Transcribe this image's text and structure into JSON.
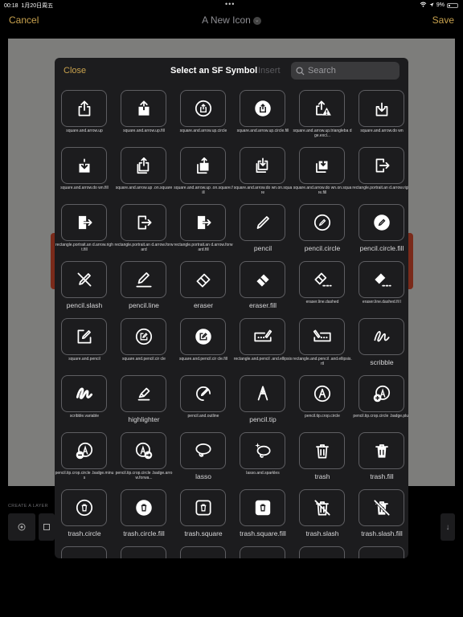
{
  "status": {
    "time": "00:18",
    "date": "1月20日周五",
    "battery": "9%"
  },
  "nav": {
    "cancel": "Cancel",
    "title": "A New Icon",
    "save": "Save"
  },
  "layer": {
    "label": "CREATE A LAYER"
  },
  "modal": {
    "close": "Close",
    "title": "Select an SF Symbol",
    "insert": "Insert",
    "search_placeholder": "Search"
  },
  "symbols": [
    {
      "name": "square.and.arrow.up",
      "size": "small",
      "icon": "share"
    },
    {
      "name": "square.and.arrow.up.fill",
      "size": "small",
      "icon": "share-fill"
    },
    {
      "name": "square.and.arrow.up.circle",
      "size": "small",
      "icon": "share-circle"
    },
    {
      "name": "square.and.arrow.up.circle.fill",
      "size": "small",
      "icon": "share-circle-fill"
    },
    {
      "name": "square.and.arrow.up.triangleba dge.excl...",
      "size": "small",
      "icon": "share-warning"
    },
    {
      "name": "square.and.arrow.do wn",
      "size": "small",
      "icon": "download"
    },
    {
      "name": "square.and.arrow.do wn.fill",
      "size": "small",
      "icon": "download-fill"
    },
    {
      "name": "square.and.arrow.up .on.square",
      "size": "small",
      "icon": "share-on-square"
    },
    {
      "name": "square.and.arrow.up .on.square.fill",
      "size": "small",
      "icon": "share-on-square-fill"
    },
    {
      "name": "square.and.arrow.do wn.on.square",
      "size": "small",
      "icon": "download-on-square"
    },
    {
      "name": "square.and.arrow.do wn.on.square.fill",
      "size": "small",
      "icon": "download-on-square-fill"
    },
    {
      "name": "rectangle.portrait.an d.arrow.right",
      "size": "small",
      "icon": "portrait-arrow"
    },
    {
      "name": "rectangle.portrait.an d.arrow.right.fill",
      "size": "small",
      "icon": "portrait-arrow-fill"
    },
    {
      "name": "rectangle.portrait.an d.arrow.forward",
      "size": "small",
      "icon": "portrait-arrow"
    },
    {
      "name": "rectangle.portrait.an d.arrow.forward.fill",
      "size": "small",
      "icon": "portrait-arrow-fill"
    },
    {
      "name": "pencil",
      "size": "big",
      "icon": "pencil"
    },
    {
      "name": "pencil.circle",
      "size": "big",
      "icon": "pencil-circle"
    },
    {
      "name": "pencil.circle.fill",
      "size": "big",
      "icon": "pencil-circle-fill"
    },
    {
      "name": "pencil.slash",
      "size": "big",
      "icon": "pencil-slash"
    },
    {
      "name": "pencil.line",
      "size": "big",
      "icon": "pencil-line"
    },
    {
      "name": "eraser",
      "size": "big",
      "icon": "eraser"
    },
    {
      "name": "eraser.fill",
      "size": "big",
      "icon": "eraser-fill"
    },
    {
      "name": "eraser.line.dashed",
      "size": "small",
      "icon": "eraser-dashed"
    },
    {
      "name": "eraser.line.dashed.fil l",
      "size": "small",
      "icon": "eraser-dashed-fill"
    },
    {
      "name": "square.and.pencil",
      "size": "small",
      "icon": "square-pencil"
    },
    {
      "name": "square.and.pencil.cir cle",
      "size": "small",
      "icon": "square-pencil-circle"
    },
    {
      "name": "square.and.pencil.cir cle.fill",
      "size": "small",
      "icon": "square-pencil-circle-fill"
    },
    {
      "name": "rectangle.and.pencil .and.ellipsis",
      "size": "small",
      "icon": "rect-pencil-ellipsis"
    },
    {
      "name": "rectangle.and.pencil .and.ellipsis.rtl",
      "size": "small",
      "icon": "rect-pencil-ellipsis-rtl"
    },
    {
      "name": "scribble",
      "size": "big",
      "icon": "scribble"
    },
    {
      "name": "scribble.variable",
      "size": "small",
      "icon": "scribble-variable"
    },
    {
      "name": "highlighter",
      "size": "big",
      "icon": "highlighter"
    },
    {
      "name": "pencil.and.outline",
      "size": "small",
      "icon": "pencil-outline"
    },
    {
      "name": "pencil.tip",
      "size": "big",
      "icon": "pencil-tip"
    },
    {
      "name": "pencil.tip.crop.circle",
      "size": "small",
      "icon": "tip-circle"
    },
    {
      "name": "pencil.tip.crop.circle .badge.plus",
      "size": "small",
      "icon": "tip-circle-plus"
    },
    {
      "name": "pencil.tip.crop.circle .badge.minus",
      "size": "small",
      "icon": "tip-circle-minus"
    },
    {
      "name": "pencil.tip.crop.circle .badge.arrow.forwa...",
      "size": "small",
      "icon": "tip-circle-arrow"
    },
    {
      "name": "lasso",
      "size": "big",
      "icon": "lasso"
    },
    {
      "name": "lasso.and.sparkles",
      "size": "small",
      "icon": "lasso-sparkles"
    },
    {
      "name": "trash",
      "size": "big",
      "icon": "trash"
    },
    {
      "name": "trash.fill",
      "size": "big",
      "icon": "trash-fill"
    },
    {
      "name": "trash.circle",
      "size": "big",
      "icon": "trash-circle"
    },
    {
      "name": "trash.circle.fill",
      "size": "big",
      "icon": "trash-circle-fill"
    },
    {
      "name": "trash.square",
      "size": "big",
      "icon": "trash-square"
    },
    {
      "name": "trash.square.fill",
      "size": "big",
      "icon": "trash-square-fill"
    },
    {
      "name": "trash.slash",
      "size": "big",
      "icon": "trash-slash"
    },
    {
      "name": "trash.slash.fill",
      "size": "big",
      "icon": "trash-slash-fill"
    },
    {
      "name": "",
      "size": "big",
      "icon": "partial-circle"
    },
    {
      "name": "",
      "size": "big",
      "icon": "partial-circle-fill"
    },
    {
      "name": "",
      "size": "big",
      "icon": "partial-square"
    },
    {
      "name": "",
      "size": "big",
      "icon": "partial-square-fill"
    },
    {
      "name": "",
      "size": "big",
      "icon": "folder"
    },
    {
      "name": "",
      "size": "big",
      "icon": "folder-fill"
    }
  ]
}
